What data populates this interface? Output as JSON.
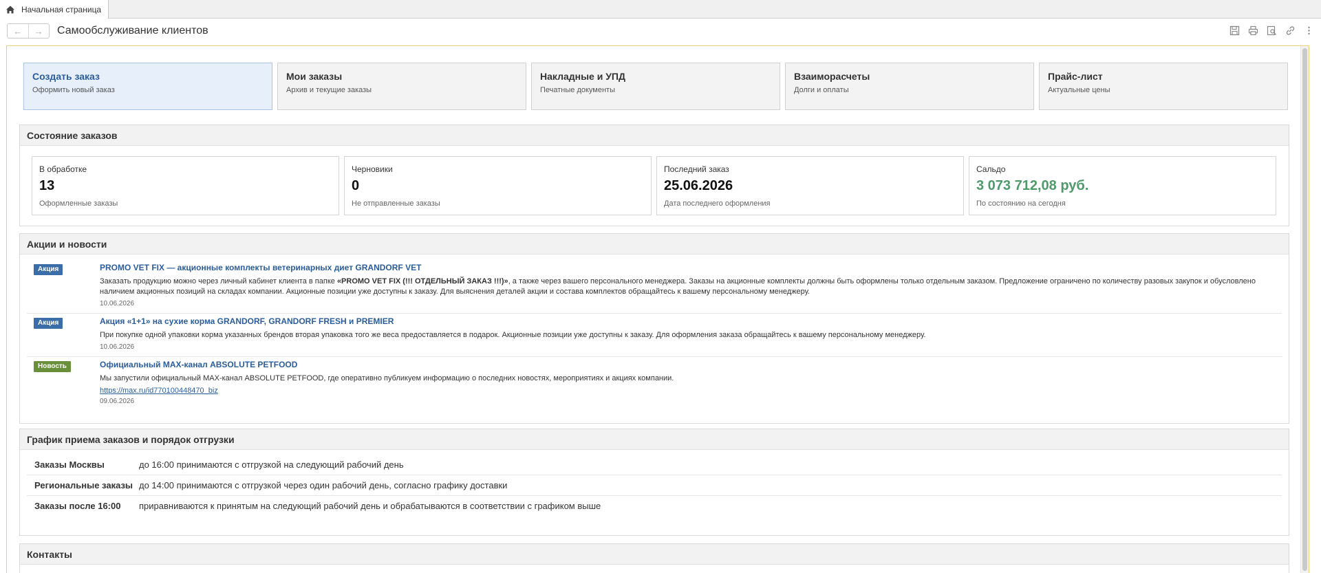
{
  "tab": {
    "label": "Начальная страница"
  },
  "window": {
    "title": "Самообслуживание клиентов"
  },
  "actions": [
    {
      "title": "Создать заказ",
      "subtitle": "Оформить новый заказ"
    },
    {
      "title": "Мои заказы",
      "subtitle": "Архив и текущие заказы"
    },
    {
      "title": "Накладные и УПД",
      "subtitle": "Печатные документы"
    },
    {
      "title": "Взаиморасчеты",
      "subtitle": "Долги и оплаты"
    },
    {
      "title": "Прайс-лист",
      "subtitle": "Актуальные цены"
    }
  ],
  "status": {
    "title": "Состояние заказов",
    "items": [
      {
        "label": "В обработке",
        "value": "13",
        "sub": "Оформленные заказы"
      },
      {
        "label": "Черновики",
        "value": "0",
        "sub": "Не отправленные заказы"
      },
      {
        "label": "Последний заказ",
        "value": "25.06.2026",
        "sub": "Дата последнего оформления"
      },
      {
        "label": "Сальдо",
        "value": "3 073 712,08 руб.",
        "sub": "По состоянию на сегодня"
      }
    ],
    "saldo_color": "#4f9a6b"
  },
  "news": {
    "title": "Акции и новости",
    "items": [
      {
        "badge": "Акция",
        "title": "PROMO VET FIX — акционные комплекты ветеринарных диет GRANDORF VET",
        "text_before": "Заказать продукцию можно через личный кабинет клиента в папке ",
        "text_bold": "«PROMO VET FIX (!!! ОТДЕЛЬНЫЙ ЗАКАЗ !!!)»",
        "text_after": ", а также через вашего персонального менеджера. Заказы на акционные комплекты должны быть оформлены только отдельным заказом. Предложение ограничено по количеству разовых закупок и обусловлено наличием акционных позиций на складах компании. Акционные позиции уже доступны к заказу. Для выяснения деталей акции и состава комплектов обращайтесь к вашему персональному менеджеру.",
        "date": "10.06.2026"
      },
      {
        "badge": "Акция",
        "title": "Акция «1+1» на сухие корма GRANDORF, GRANDORF FRESH и PREMIER",
        "text": "При покупке одной упаковки корма указанных брендов вторая упаковка того же веса предоставляется в подарок. Акционные позиции уже доступны к заказу. Для оформления заказа обращайтесь к вашему персональному менеджеру.",
        "date": "10.06.2026"
      },
      {
        "badge": "Новость",
        "title": "Официальный MAX-канал ABSOLUTE PETFOOD",
        "text": "Мы запустили официальный MAX-канал ABSOLUTE PETFOOD, где оперативно публикуем информацию о последних новостях, мероприятиях и акциях компании.",
        "link": "https://max.ru/id770100448470_biz",
        "date": "09.06.2026"
      }
    ]
  },
  "schedule": {
    "title": "График приема заказов и порядок отгрузки",
    "rows": [
      {
        "key": "Заказы Москвы",
        "value": "до 16:00 принимаются с отгрузкой на следующий рабочий день"
      },
      {
        "key": "Региональные заказы",
        "value": "до 14:00 принимаются с отгрузкой через один рабочий день, согласно графику доставки"
      },
      {
        "key": "Заказы после 16:00",
        "value": "приравниваются к принятым на следующий рабочий день и обрабатываются в соответствии с графиком выше"
      }
    ]
  },
  "contacts": {
    "title": "Контакты"
  }
}
